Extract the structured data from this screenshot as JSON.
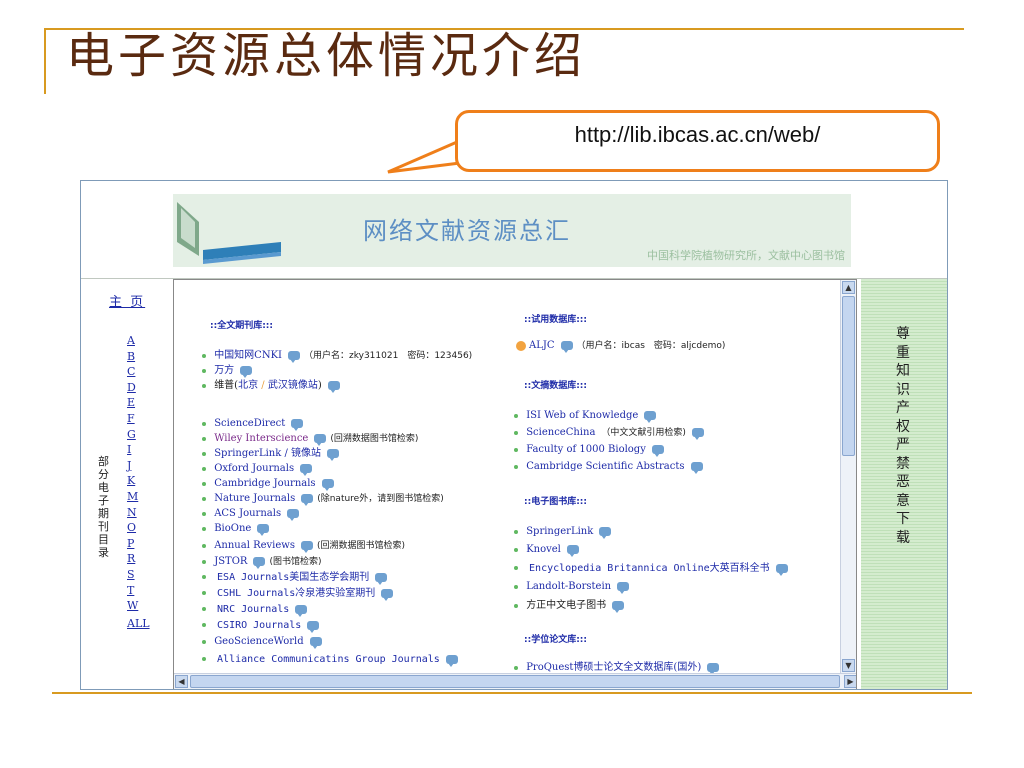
{
  "slide": {
    "title": "电子资源总体情况介绍",
    "callout_url": "http://lib.ibcas.ac.cn/web/"
  },
  "banner": {
    "title": "网络文献资源总汇",
    "subtitle": "中国科学院植物研究所，文献中心图书馆"
  },
  "left_nav": {
    "home": "主 页",
    "vertical_label": "部分电子期刊目录",
    "letters": [
      "A",
      "B",
      "C",
      "D",
      "E",
      "F",
      "G",
      "I",
      "J",
      "K",
      "M",
      "N",
      "O",
      "P",
      "R",
      "S",
      "T",
      "W"
    ],
    "all": "ALL"
  },
  "right_panel": {
    "text": "尊重知识产权 严禁恶意下载"
  },
  "sections": {
    "fulltext": "::全文期刊库:::",
    "trial": "::试用数据库:::",
    "abstract": "::文摘数据库:::",
    "ebook": "::电子图书库:::",
    "thesis": "::学位论文库:::"
  },
  "fulltext_items": {
    "cnki": {
      "name": "中国知网CNKI",
      "note": "（用户名：zky311021　密码：123456)"
    },
    "wanfang": {
      "name": "万方"
    },
    "vip": {
      "prefix": "维普(",
      "beijing": "北京",
      "sep": " / ",
      "wuhan": "武汉镜像站",
      "suffix": ")"
    },
    "sciencedirect": {
      "name": "ScienceDirect"
    },
    "wiley": {
      "name": "Wiley Interscience",
      "note": "(回溯数据图书馆检索)"
    },
    "springer": {
      "name": "SpringerLink / 镜像站"
    },
    "oxford": {
      "name": "Oxford Journals"
    },
    "cambridge": {
      "name": "Cambridge Journals"
    },
    "nature": {
      "name": "Nature Journals",
      "note": "(除nature外，请到图书馆检索)"
    },
    "acs": {
      "name": "ACS Journals"
    },
    "bioone": {
      "name": "BioOne"
    },
    "annual": {
      "name": "Annual Reviews",
      "note": "(回溯数据图书馆检索)"
    },
    "jstor": {
      "name": "JSTOR",
      "note": "(图书馆检索)"
    },
    "esa": {
      "name": "ESA Journals美国生态学会期刊"
    },
    "cshl": {
      "name": "CSHL Journals冷泉港实验室期刊"
    },
    "nrc": {
      "name": "NRC Journals"
    },
    "csiro": {
      "name": "CSIRO Journals"
    },
    "geoscience": {
      "name": "GeoScienceWorld"
    },
    "alliance": {
      "name": "Alliance Communicatins Group Journals"
    }
  },
  "trial_items": {
    "aljc": {
      "name": "ALJC",
      "note": "（用户名：ibcas　密码：aljcdemo)"
    }
  },
  "abstract_items": {
    "isi": {
      "name": "ISI Web of Knowledge"
    },
    "sciencechina": {
      "name": "ScienceChina",
      "note": "（中文文献引用检索)"
    },
    "f1000": {
      "name": "Faculty of 1000 Biology"
    },
    "csa": {
      "name": "Cambridge Scientific Abstracts"
    }
  },
  "ebook_items": {
    "springerlink": {
      "name": "SpringerLink"
    },
    "knovel": {
      "name": "Knovel"
    },
    "britannica": {
      "name": "Encyclopedia Britannica Online大英百科全书"
    },
    "landolt": {
      "name": "Landolt-Borstein"
    },
    "founder": {
      "name": "方正中文电子图书"
    }
  },
  "thesis_items": {
    "proquest": {
      "name": "ProQuest博硕士论文全文数据库(国外)"
    }
  },
  "colors": {
    "accent_orange": "#ef7f1a",
    "rule_gold": "#d89a20",
    "link_blue": "#1e2ba8",
    "panel_green": "#bfe0b8"
  }
}
